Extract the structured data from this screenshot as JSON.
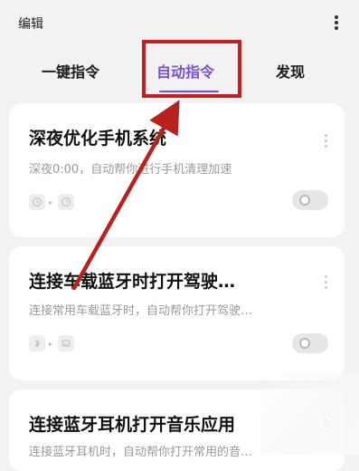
{
  "header": {
    "edit_label": "编辑",
    "more_icon": "more-vertical-icon"
  },
  "tabs": [
    {
      "label": "一键指令",
      "selected": false
    },
    {
      "label": "自动指令",
      "selected": true
    },
    {
      "label": "发现",
      "selected": false
    }
  ],
  "colors": {
    "accent": "#7b4fd1",
    "annotation_red": "#c0201e",
    "background": "#f2f2f4",
    "card": "#ffffff"
  },
  "cards": [
    {
      "title": "深夜优化手机系统",
      "desc": "深夜0:00，自动帮你进行手机清理加速",
      "trigger_icons": [
        "clock-icon",
        "speed-icon"
      ],
      "enabled": false
    },
    {
      "title": "连接车载蓝牙时打开驾驶…",
      "desc": "连接常用车载蓝牙时，自动帮你打开驾驶…",
      "trigger_icons": [
        "bluetooth-icon",
        "car-icon"
      ],
      "enabled": false
    },
    {
      "title": "连接蓝牙耳机打开音乐应用",
      "desc": "连接蓝牙耳机时，自动帮你打开常用的音…",
      "trigger_icons": [],
      "enabled": false
    }
  ]
}
